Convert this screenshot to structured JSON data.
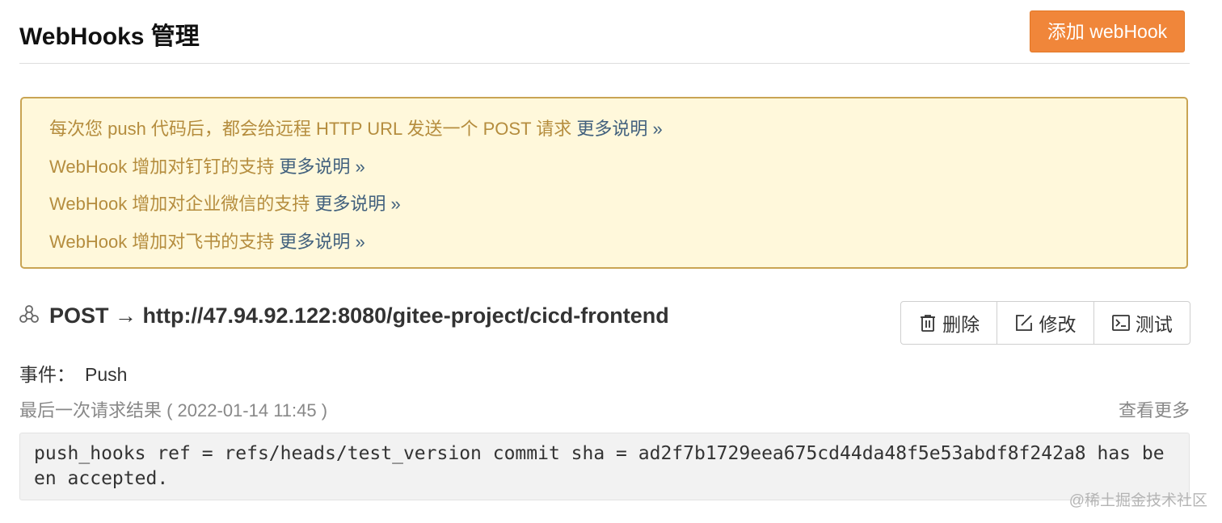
{
  "header": {
    "title": "WebHooks 管理",
    "add_button": "添加 webHook"
  },
  "notice": {
    "items": [
      {
        "text": "每次您 push 代码后，都会给远程 HTTP URL 发送一个 POST 请求 ",
        "link": "更多说明 »"
      },
      {
        "text": "WebHook 增加对钉钉的支持 ",
        "link": "更多说明 »"
      },
      {
        "text": "WebHook 增加对企业微信的支持 ",
        "link": "更多说明 »"
      },
      {
        "text": "WebHook 增加对飞书的支持 ",
        "link": "更多说明 »"
      }
    ]
  },
  "webhook": {
    "icon": "webhook-icon",
    "url_line": "POST → http://47.94.92.122:8080/gitee-project/cicd-frontend",
    "actions": {
      "delete": "删除",
      "edit": "修改",
      "test": "测试"
    },
    "event_label": "事件：",
    "event_value": "Push",
    "last_request": "最后一次请求结果 ( 2022-01-14 11:45 )",
    "view_more": "查看更多",
    "response": "push_hooks ref = refs/heads/test_version commit sha = ad2f7b1729eea675cd44da48f5e53abdf8f242a8 has been accepted."
  },
  "watermark": "@稀土掘金技术社区",
  "colors": {
    "accent_button": "#f0863a",
    "notice_bg": "#fff8db",
    "notice_text": "#b58d3e",
    "notice_link": "#41607d"
  }
}
